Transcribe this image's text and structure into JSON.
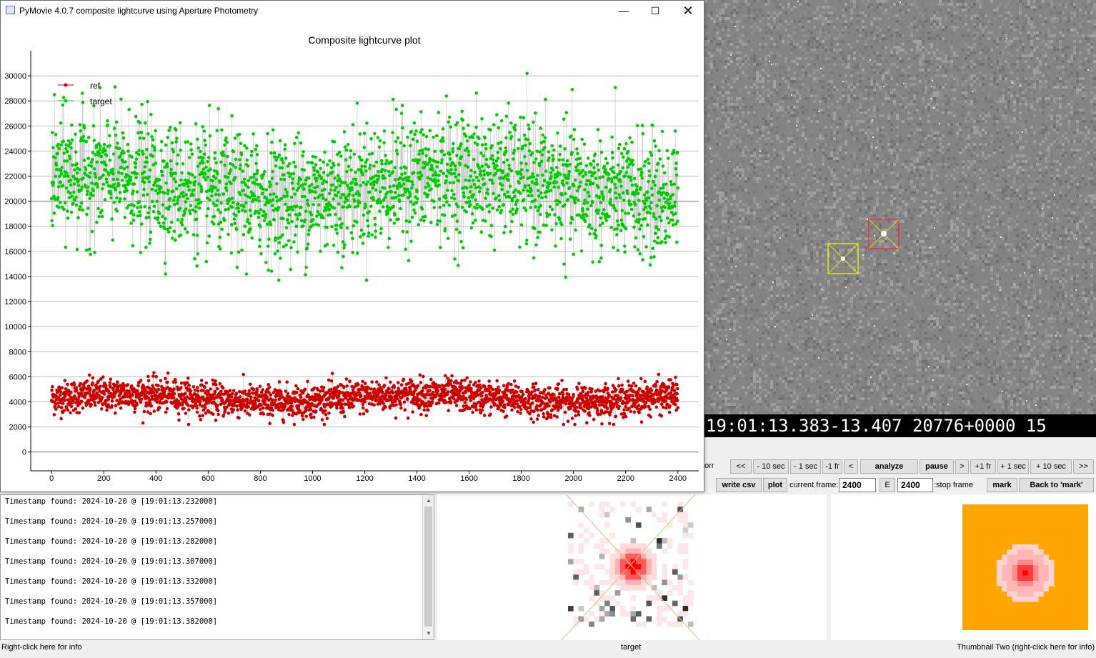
{
  "window": {
    "title": "PyMovie 4.0.7 composite lightcurve using Aperture Photometry",
    "minimize_icon": "minimize-icon",
    "maximize_icon": "maximize-icon",
    "close_icon": "close-icon"
  },
  "chart_data": {
    "type": "scatter",
    "title": "Composite lightcurve plot",
    "xlabel": "",
    "ylabel": "",
    "xlim": [
      -80,
      2480
    ],
    "ylim": [
      -1500,
      32000
    ],
    "xticks": [
      0,
      200,
      400,
      600,
      800,
      1000,
      1200,
      1400,
      1600,
      1800,
      2000,
      2200,
      2400
    ],
    "yticks": [
      0,
      2000,
      4000,
      6000,
      8000,
      10000,
      12000,
      14000,
      16000,
      18000,
      20000,
      22000,
      24000,
      26000,
      28000,
      30000
    ],
    "grid": "horizontal",
    "legend_position": "top-left",
    "x": [
      0,
      2400
    ],
    "series": [
      {
        "name": "ref",
        "color": "#cc0000",
        "mean": 4300,
        "spread": 650,
        "min": 2200,
        "max": 6700,
        "points": 2401
      },
      {
        "name": "target",
        "color": "#00cc00",
        "mean": 21200,
        "spread": 2400,
        "min": 13700,
        "max": 30400,
        "points": 2401
      }
    ]
  },
  "star_field": {
    "timestamp_text": "19:01:13.383-13.407 20776+0000   15",
    "ref_aperture_color": "#ffff00",
    "target_aperture_color": "#ff0000"
  },
  "controls": {
    "corr_label": "orr",
    "back10_label": "<<",
    "minus10sec_label": "- 10 sec",
    "minus1sec_label": "- 1 sec",
    "minus1fr_label": "-1 fr",
    "back1_label": "<",
    "analyze_label": "analyze",
    "pause_label": "pause",
    "fwd1_label": ">",
    "plus1fr_label": "+1 fr",
    "plus1sec_label": "+ 1 sec",
    "plus10sec_label": "+ 10 sec",
    "fwd10_label": ">>",
    "write_csv_label": "write csv",
    "plot_label": "plot",
    "current_frame_label": "current frame:",
    "current_frame_value": "2400",
    "e_label": "E",
    "stop_frame_value": "2400",
    "stop_frame_label": ":stop frame",
    "mark_label": "mark",
    "back_to_mark_label": "Back to 'mark'"
  },
  "log": {
    "lines": [
      "Timestamp found: 2024-10-20 @ [19:01:13.232000]",
      "Timestamp found: 2024-10-20 @ [19:01:13.257000]",
      "Timestamp found: 2024-10-20 @ [19:01:13.282000]",
      "Timestamp found: 2024-10-20 @ [19:01:13.307000]",
      "Timestamp found: 2024-10-20 @ [19:01:13.332000]",
      "Timestamp found: 2024-10-20 @ [19:01:13.357000]",
      "Timestamp found: 2024-10-20 @ [19:01:13.382000]"
    ],
    "info_label": "Right-click here for info"
  },
  "thumbnails": {
    "one_label": "target",
    "two_label": "Thumbnail Two (right-click here for info)",
    "two_background": "#ffa500"
  }
}
